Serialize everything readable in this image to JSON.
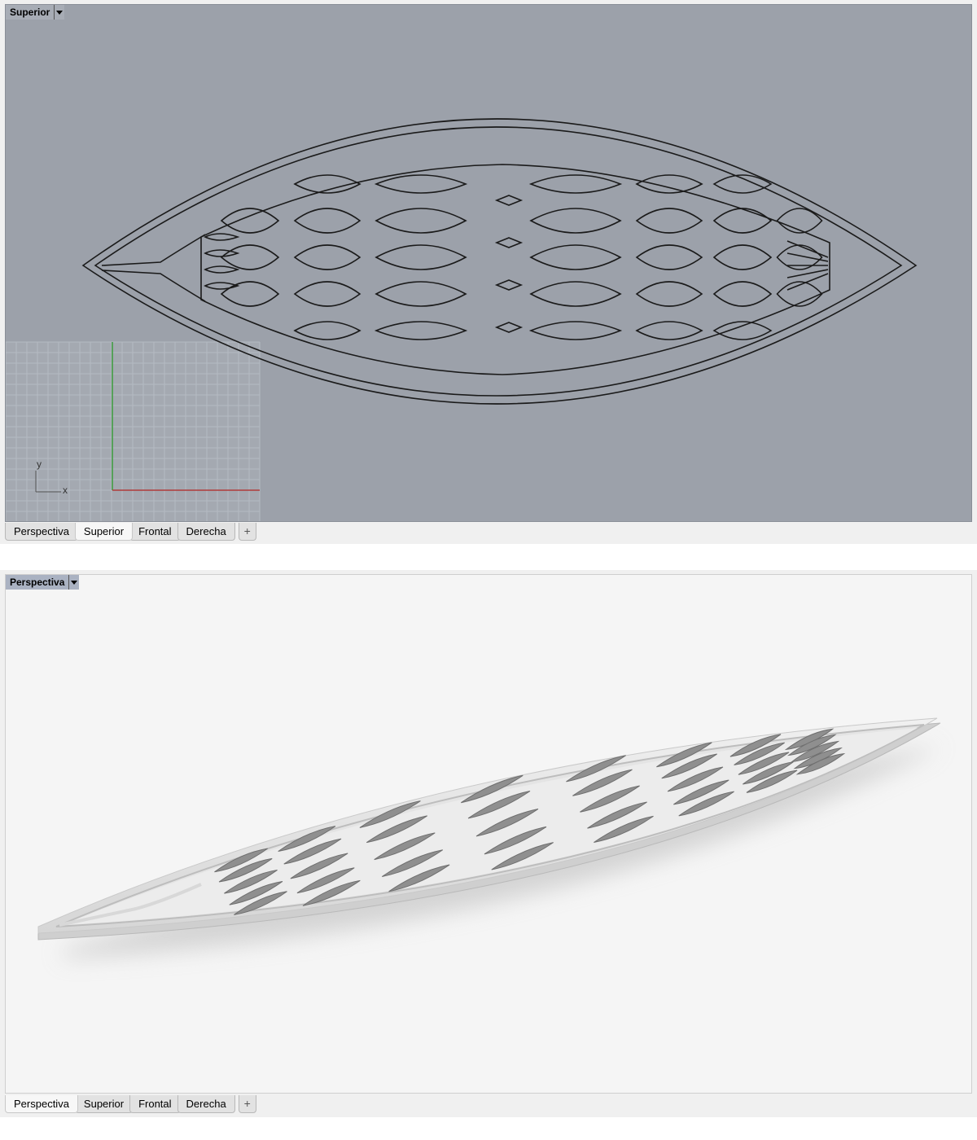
{
  "top_viewport": {
    "title": "Superior",
    "axis_labels": {
      "y": "y",
      "x": "x"
    },
    "colors": {
      "background": "#9ca1aa",
      "grid": "#aeb3bb",
      "x_axis": "#b03a3a",
      "y_axis": "#3a9a3a",
      "curves": "#1a1a1a"
    }
  },
  "bottom_viewport": {
    "title": "Perspectiva",
    "colors": {
      "background": "#f5f5f5",
      "model": "#e8e8e8",
      "shadow": "#c4c4c4"
    }
  },
  "tabs_top": [
    {
      "label": "Perspectiva",
      "active": false
    },
    {
      "label": "Superior",
      "active": true
    },
    {
      "label": "Frontal",
      "active": false
    },
    {
      "label": "Derecha",
      "active": false
    }
  ],
  "tabs_bottom": [
    {
      "label": "Perspectiva",
      "active": true
    },
    {
      "label": "Superior",
      "active": false
    },
    {
      "label": "Frontal",
      "active": false
    },
    {
      "label": "Derecha",
      "active": false
    }
  ],
  "add_tab_icon": "plus-icon",
  "viewport_menu_icon": "triangle-down-icon"
}
